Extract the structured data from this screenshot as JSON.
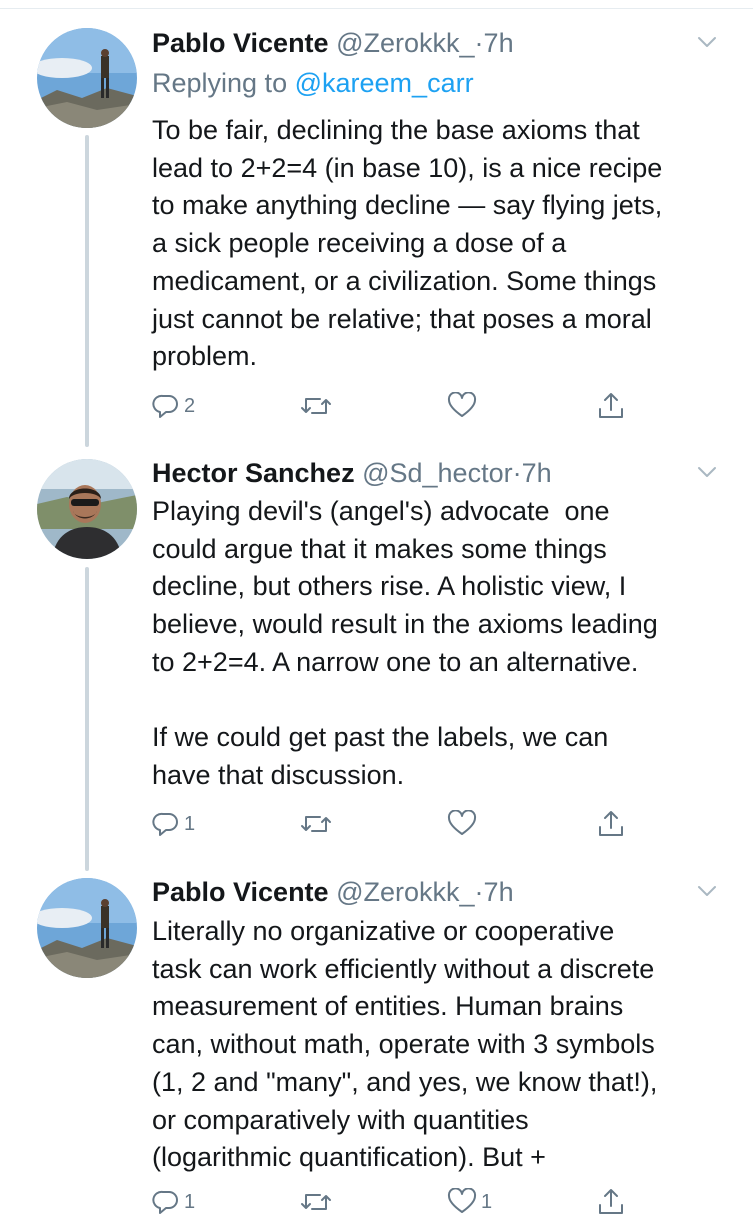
{
  "tweets": [
    {
      "name": "Pablo Vicente",
      "handle": "@Zerokkk_",
      "sep": "·",
      "time": "7h",
      "reply_prefix": "Replying to",
      "reply_handle": "@kareem_carr",
      "text": "To be fair, declining the base axioms that\nlead to 2+2=4 (in base 10), is a nice recipe\nto make anything decline — say flying jets,\na sick people receiving a dose of a\nmedicament, or a civilization. Some things\njust cannot be relative; that poses a moral\nproblem.",
      "reply_count": "2",
      "retweet_count": "",
      "like_count": ""
    },
    {
      "name": "Hector Sanchez",
      "handle": "@Sd_hector",
      "sep": "·",
      "time": "7h",
      "text": "Playing devil's (angel's) advocate  one\ncould argue that it makes some things\ndecline, but others rise. A holistic view, I\nbelieve, would result in the axioms leading\nto 2+2=4. A narrow one to an alternative.\n\nIf we could get past the labels, we can\nhave that discussion.",
      "reply_count": "1",
      "retweet_count": "",
      "like_count": ""
    },
    {
      "name": "Pablo Vicente",
      "handle": "@Zerokkk_",
      "sep": "·",
      "time": "7h",
      "text": "Literally no organizative or cooperative\ntask can work efficiently without a discrete\nmeasurement of entities. Human brains\ncan, without math, operate with 3 symbols\n(1, 2 and \"many\", and yes, we know that!),\nor comparatively with quantities\n(logarithmic quantification). But +",
      "reply_count": "1",
      "retweet_count": "",
      "like_count": "1"
    }
  ],
  "icons": {
    "reply": "reply-icon",
    "retweet": "retweet-icon",
    "like": "heart-icon",
    "share": "share-icon",
    "menu": "chevron-down-icon"
  },
  "colors": {
    "text": "#14171a",
    "secondary": "#657786",
    "link": "#1da1f2",
    "thread_line": "#ccd6dd"
  }
}
